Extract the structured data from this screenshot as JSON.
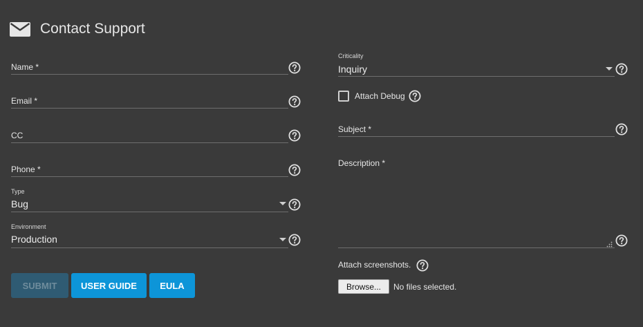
{
  "header": {
    "title": "Contact Support",
    "icon": "envelope-icon"
  },
  "left": {
    "name": {
      "label": "Name *"
    },
    "email": {
      "label": "Email *"
    },
    "cc": {
      "label": "CC"
    },
    "phone": {
      "label": "Phone *"
    },
    "type": {
      "label": "Type",
      "value": "Bug"
    },
    "environment": {
      "label": "Environment",
      "value": "Production"
    }
  },
  "right": {
    "criticality": {
      "label": "Criticality",
      "value": "Inquiry"
    },
    "attach_debug": {
      "label": "Attach Debug",
      "checked": false
    },
    "subject": {
      "label": "Subject *"
    },
    "description": {
      "label": "Description *"
    },
    "attach_screenshots": {
      "label": "Attach screenshots.",
      "browse_label": "Browse...",
      "status": "No files selected."
    }
  },
  "buttons": {
    "submit": "SUBMIT",
    "user_guide": "USER GUIDE",
    "eula": "EULA"
  },
  "colors": {
    "background": "#3a3a3a",
    "accent": "#0d95d8",
    "disabled_button": "#2f5b73"
  }
}
